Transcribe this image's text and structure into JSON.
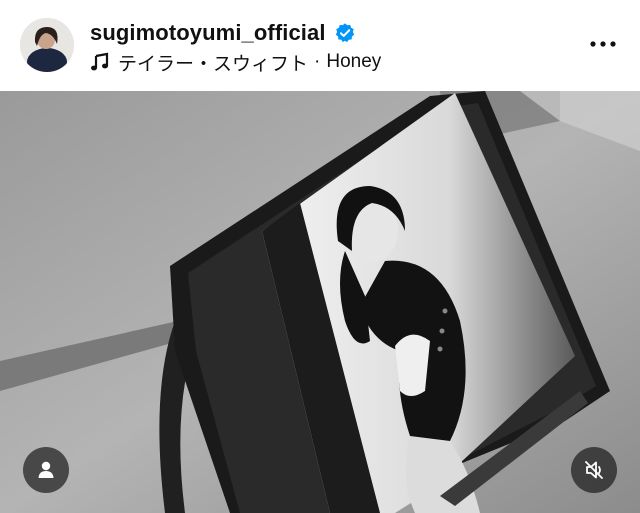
{
  "post": {
    "username": "sugimotoyumi_official",
    "verified": true,
    "music": {
      "artist": "テイラー・スウィフト",
      "separator": "·",
      "track": "Honey"
    }
  },
  "icons": {
    "verified": "verified-badge-icon",
    "music": "music-note-icon",
    "more": "more-options-icon",
    "tagged_users": "user-icon",
    "audio": "speaker-muted-icon"
  },
  "colors": {
    "verified_blue": "#0095f6",
    "text": "#111111",
    "overlay_button": "#1e1e1e"
  }
}
